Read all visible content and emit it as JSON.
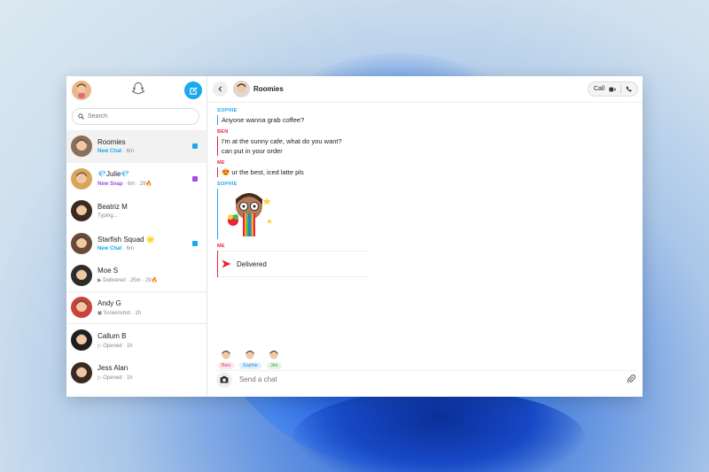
{
  "colors": {
    "accent": "#1aa8ef",
    "sophie": "#1aa8ef",
    "ben": "#e8243a",
    "me": "#e8243a",
    "new_chat": "#1aa8ef",
    "new_snap": "#9b51e0",
    "delivered_arrow": "#e8243a"
  },
  "sidebar": {
    "search_placeholder": "Search",
    "chats": [
      {
        "name": "Roomies",
        "status": "New Chat",
        "meta": " · 6m",
        "status_color": "#1aa8ef",
        "indicator": "#1aa8ef",
        "avatar": "#8a6f5a"
      },
      {
        "name": "💎Julie💎",
        "status": "New Snap",
        "meta": " · 6m · 29🔥",
        "status_color": "#9b51e0",
        "indicator": "#9b51e0",
        "avatar": "#d9a55a"
      },
      {
        "name": "Beatriz M",
        "status": "",
        "meta": "Typing...",
        "status_color": "#888888",
        "indicator": "",
        "avatar": "#3b2a22"
      },
      {
        "name": "Starfish Squad 🌟",
        "status": "New Chat",
        "meta": " · 6m",
        "status_color": "#1aa8ef",
        "indicator": "#1aa8ef",
        "avatar": "#6b4a3a"
      },
      {
        "name": "Moe S",
        "status": "",
        "meta": "▶ Delivered · 25m · 29🔥",
        "status_color": "#888888",
        "indicator": "",
        "avatar": "#2d2d2d"
      },
      {
        "name": "Andy G",
        "status": "",
        "meta": "◼ Screenshot · 1h",
        "status_color": "#888888",
        "indicator": "",
        "avatar": "#c8433a"
      },
      {
        "name": "Callum B",
        "status": "",
        "meta": "▷ Opened · 1h",
        "status_color": "#888888",
        "indicator": "",
        "avatar": "#1f1f1f"
      },
      {
        "name": "Jess Alan",
        "status": "",
        "meta": "▷ Opened · 1h",
        "status_color": "#888888",
        "indicator": "",
        "avatar": "#3b2a22"
      }
    ]
  },
  "main": {
    "title": "Roomies",
    "call_label": "Call",
    "messages": [
      {
        "sender": "SOPHIE",
        "color": "#1aa8ef",
        "lines": [
          "Anyone wanna grab coffee?"
        ]
      },
      {
        "sender": "BEN",
        "color": "#e8243a",
        "lines": [
          "I'm at the sunny cafe, what do you want?",
          "can put in your order"
        ]
      },
      {
        "sender": "ME",
        "color": "#e8243a",
        "lines": [
          "😍 ur the best, iced latte pls"
        ]
      }
    ],
    "sticker_sender": "SOPHIE",
    "delivered_sender": "ME",
    "delivered_label": "Delivered",
    "present": [
      {
        "label": "Ben",
        "bg": "#fde3ea",
        "fg": "#d4405e"
      },
      {
        "label": "Sophie",
        "bg": "#e0f1fc",
        "fg": "#1a8fd0"
      },
      {
        "label": "Jim",
        "bg": "#e3f6e2",
        "fg": "#3e9a3c"
      }
    ],
    "compose_placeholder": "Send a chat"
  }
}
